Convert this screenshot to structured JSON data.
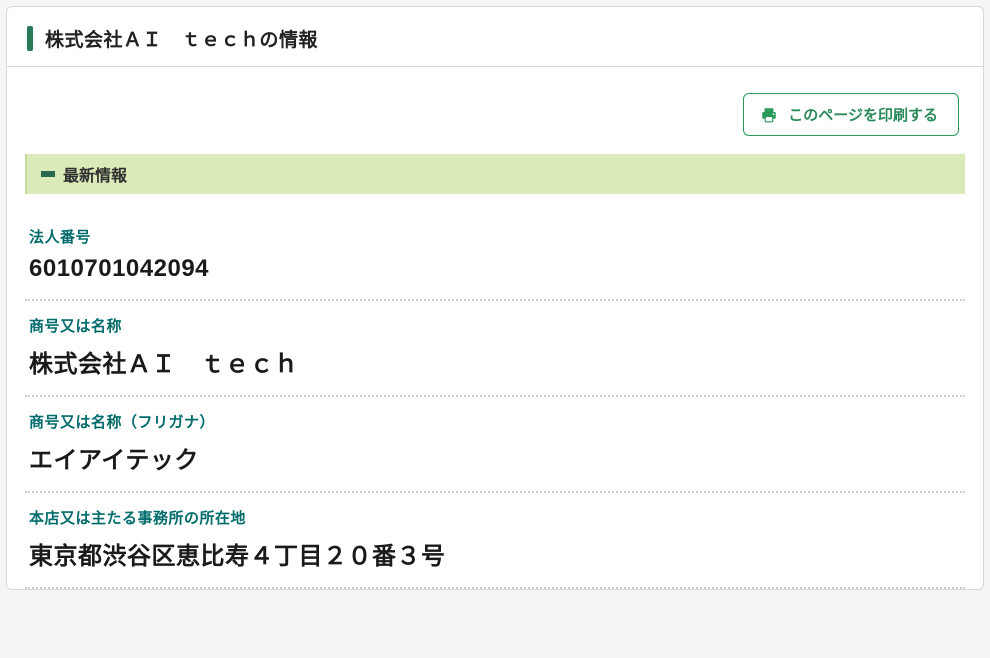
{
  "header": {
    "title": "株式会社ＡＩ　ｔｅｃｈの情報"
  },
  "print_button": {
    "label": "このページを印刷する"
  },
  "section": {
    "title": "最新情報"
  },
  "fields": [
    {
      "label": "法人番号",
      "value": "6010701042094"
    },
    {
      "label": "商号又は名称",
      "value": "株式会社ＡＩ　ｔｅｃｈ"
    },
    {
      "label": "商号又は名称（フリガナ）",
      "value": "エイアイテック"
    },
    {
      "label": "本店又は主たる事務所の所在地",
      "value": "東京都渋谷区恵比寿４丁目２０番３号"
    }
  ]
}
